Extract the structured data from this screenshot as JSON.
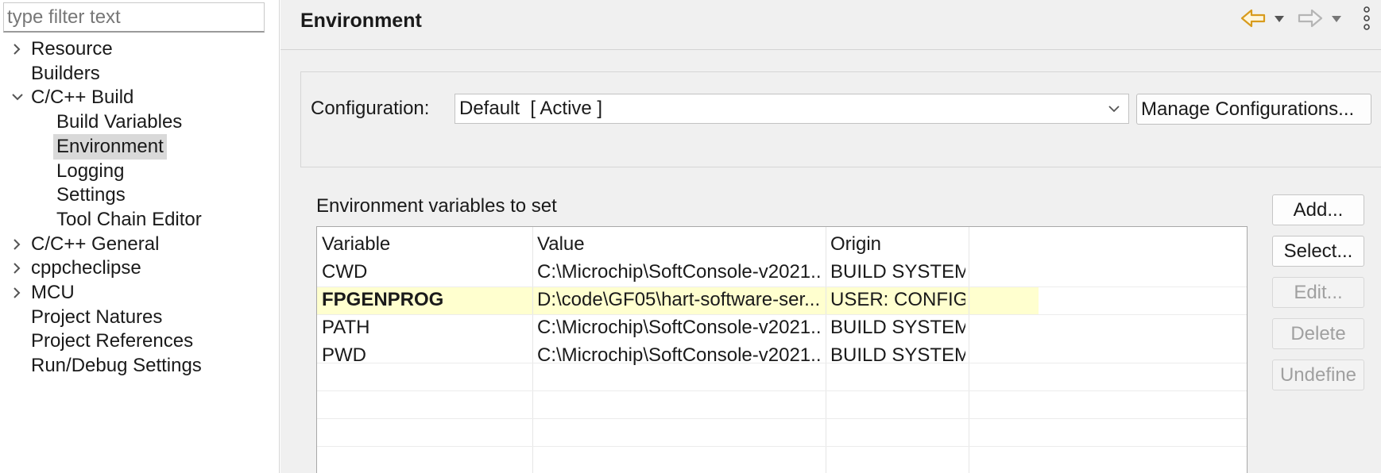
{
  "filter": {
    "placeholder": "type filter text"
  },
  "tree": {
    "items": [
      {
        "label": "Resource",
        "twisty": "collapsed"
      },
      {
        "label": "Builders",
        "twisty": "none"
      },
      {
        "label": "C/C++ Build",
        "twisty": "expanded"
      },
      {
        "label": "Build Variables",
        "twisty": "none"
      },
      {
        "label": "Environment",
        "twisty": "none",
        "selected": true
      },
      {
        "label": "Logging",
        "twisty": "none"
      },
      {
        "label": "Settings",
        "twisty": "none"
      },
      {
        "label": "Tool Chain Editor",
        "twisty": "none"
      },
      {
        "label": "C/C++ General",
        "twisty": "collapsed"
      },
      {
        "label": "cppcheclipse",
        "twisty": "collapsed"
      },
      {
        "label": "MCU",
        "twisty": "collapsed"
      },
      {
        "label": "Project Natures",
        "twisty": "none"
      },
      {
        "label": "Project References",
        "twisty": "none"
      },
      {
        "label": "Run/Debug Settings",
        "twisty": "none"
      }
    ]
  },
  "page": {
    "title": "Environment"
  },
  "toolbar": {
    "back_icon": "arrow-left-icon",
    "forward_icon": "arrow-right-icon",
    "menu_icon": "kebab-menu-icon",
    "back_color": "#d89b1d"
  },
  "config": {
    "label": "Configuration:",
    "value": "Default  [ Active ]",
    "manage_label": "Manage Configurations..."
  },
  "env": {
    "section_label": "Environment variables to set",
    "columns": [
      "Variable",
      "Value",
      "Origin"
    ],
    "rows": [
      {
        "variable": "CWD",
        "value": "C:\\Microchip\\SoftConsole-v2021...",
        "origin": "BUILD SYSTEM"
      },
      {
        "variable": "FPGENPROG",
        "value": "D:\\code\\GF05\\hart-software-ser...",
        "origin": "USER: CONFIG"
      },
      {
        "variable": "PATH",
        "value": "C:\\Microchip\\SoftConsole-v2021...",
        "origin": "BUILD SYSTEM"
      },
      {
        "variable": "PWD",
        "value": "C:\\Microchip\\SoftConsole-v2021...",
        "origin": "BUILD SYSTEM"
      }
    ]
  },
  "buttons": {
    "add": "Add...",
    "select": "Select...",
    "edit": "Edit...",
    "delete": "Delete",
    "undefine": "Undefine"
  }
}
